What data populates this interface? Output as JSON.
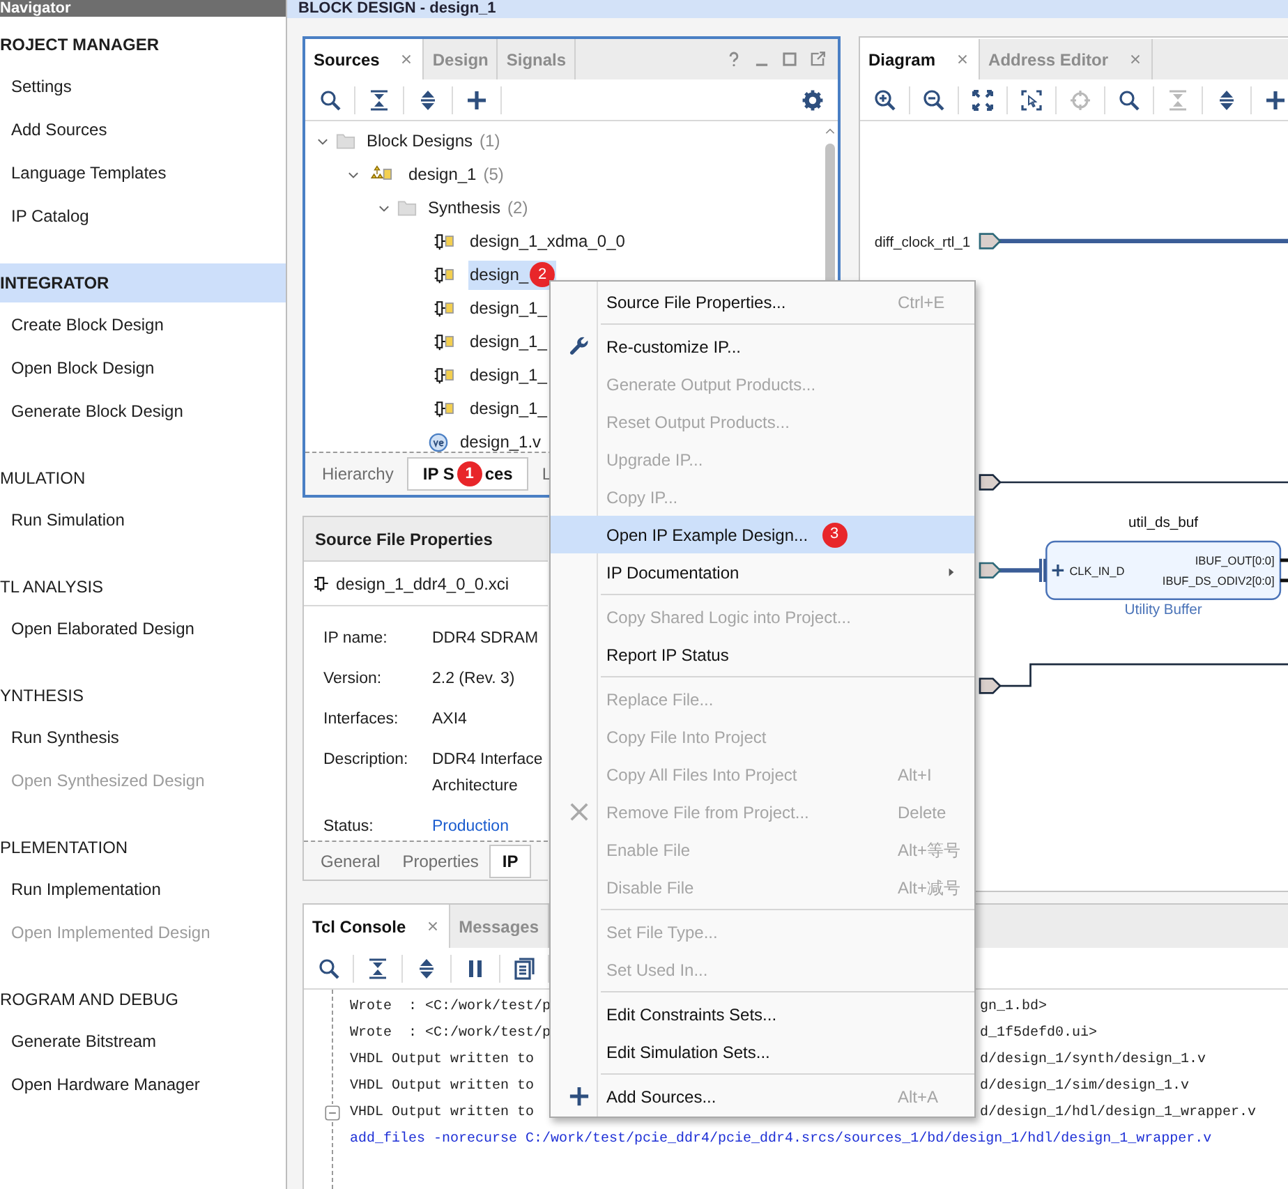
{
  "navigator": {
    "title": "Navigator",
    "sections": [
      {
        "title": "ROJECT MANAGER",
        "emphasized": true,
        "selected": false,
        "items": [
          {
            "label": "Settings",
            "disabled": false
          },
          {
            "label": "Add Sources",
            "disabled": false
          },
          {
            "label": "Language Templates",
            "disabled": false
          },
          {
            "label": "IP Catalog",
            "disabled": false
          }
        ]
      },
      {
        "title": "INTEGRATOR",
        "emphasized": true,
        "selected": true,
        "items": [
          {
            "label": "Create Block Design",
            "disabled": false
          },
          {
            "label": "Open Block Design",
            "disabled": false
          },
          {
            "label": "Generate Block Design",
            "disabled": false
          }
        ]
      },
      {
        "title": "MULATION",
        "emphasized": false,
        "selected": false,
        "items": [
          {
            "label": "Run Simulation",
            "disabled": false
          }
        ]
      },
      {
        "title": "TL ANALYSIS",
        "emphasized": false,
        "selected": false,
        "items": [
          {
            "label": "Open Elaborated Design",
            "disabled": false
          }
        ]
      },
      {
        "title": "YNTHESIS",
        "emphasized": false,
        "selected": false,
        "items": [
          {
            "label": "Run Synthesis",
            "disabled": false
          },
          {
            "label": "Open Synthesized Design",
            "disabled": true
          }
        ]
      },
      {
        "title": "PLEMENTATION",
        "emphasized": false,
        "selected": false,
        "items": [
          {
            "label": "Run Implementation",
            "disabled": false
          },
          {
            "label": "Open Implemented Design",
            "disabled": true
          }
        ]
      },
      {
        "title": "ROGRAM AND DEBUG",
        "emphasized": false,
        "selected": false,
        "items": [
          {
            "label": "Generate Bitstream",
            "disabled": false
          },
          {
            "label": "Open Hardware Manager",
            "disabled": false
          }
        ]
      }
    ]
  },
  "header": "BLOCK DESIGN - design_1",
  "sources": {
    "tabs": [
      {
        "label": "Sources",
        "selected": true,
        "closable": true
      },
      {
        "label": "Design",
        "selected": false,
        "closable": false
      },
      {
        "label": "Signals",
        "selected": false,
        "closable": false
      }
    ],
    "toolbar": [
      {
        "kind": "search",
        "disabled": false
      },
      {
        "kind": "collapse",
        "disabled": false
      },
      {
        "kind": "expand",
        "disabled": false
      },
      {
        "kind": "add",
        "disabled": false
      },
      {
        "kind": "settings",
        "disabled": false
      }
    ],
    "tree": [
      {
        "label": "Block Designs",
        "count": "(1)",
        "kind": "folder",
        "selected": false,
        "expanded": true,
        "children": [
          {
            "label": "design_1",
            "count": "(5)",
            "kind": "design",
            "selected": false,
            "expanded": true,
            "children": [
              {
                "label": "Synthesis",
                "count": "(2)",
                "kind": "folder",
                "selected": false,
                "expanded": true,
                "children": [
                  {
                    "label": "design_1_xdma_0_0",
                    "kind": "ip",
                    "selected": false
                  },
                  {
                    "label": "design_",
                    "kind": "ip",
                    "selected": true,
                    "badge": "2"
                  },
                  {
                    "label": "design_1_",
                    "kind": "ip",
                    "selected": false
                  },
                  {
                    "label": "design_1_",
                    "kind": "ip",
                    "selected": false
                  },
                  {
                    "label": "design_1_",
                    "kind": "ip",
                    "selected": false
                  },
                  {
                    "label": "design_1_",
                    "kind": "ip",
                    "selected": false
                  },
                  {
                    "label": "design_1.v",
                    "kind": "file",
                    "selected": false
                  }
                ]
              }
            ]
          }
        ]
      }
    ],
    "bottom_tabs": [
      {
        "label": "Hierarchy",
        "selected": false
      },
      {
        "label": "IP S",
        "badge": "1",
        "label_end": "ces",
        "selected": true
      },
      {
        "label": "L",
        "selected": false
      }
    ]
  },
  "properties": {
    "title": "Source File Properties",
    "file": "design_1_ddr4_0_0.xci",
    "fields": [
      {
        "label": "IP name:",
        "lines": [
          "DDR4 SDRAM"
        ],
        "kind": "text"
      },
      {
        "label": "Version:",
        "lines": [
          "2.2 (Rev. 3)"
        ],
        "kind": "text"
      },
      {
        "label": "Interfaces:",
        "lines": [
          "AXI4"
        ],
        "kind": "text"
      },
      {
        "label": "Description:",
        "lines": [
          "DDR4 Interface",
          "Architecture"
        ],
        "kind": "text"
      },
      {
        "label": "Status:",
        "lines": [
          "Production"
        ],
        "kind": "link"
      }
    ],
    "tabs": [
      {
        "label": "General",
        "selected": false
      },
      {
        "label": "Properties",
        "selected": false
      },
      {
        "label": "IP",
        "selected": true
      }
    ]
  },
  "diagram": {
    "tabs": [
      {
        "label": "Diagram",
        "selected": true,
        "closable": true
      },
      {
        "label": "Address Editor",
        "selected": false,
        "closable": true
      }
    ],
    "toolbar": [
      {
        "kind": "zoom_in",
        "disabled": false
      },
      {
        "kind": "zoom_out",
        "disabled": false
      },
      {
        "kind": "fit",
        "disabled": false
      },
      {
        "kind": "select_area",
        "disabled": false
      },
      {
        "kind": "center",
        "disabled": true
      },
      {
        "kind": "search",
        "disabled": false
      },
      {
        "kind": "collapse",
        "disabled": true
      },
      {
        "kind": "expand",
        "disabled": false
      },
      {
        "kind": "add",
        "disabled": false
      }
    ],
    "ports": [
      {
        "label": "diff_clock_rtl_1",
        "kind": "bus"
      },
      {
        "kind": "net"
      },
      {
        "kind": "bus"
      },
      {
        "kind": "net"
      }
    ],
    "block": {
      "name": "util_ds_buf",
      "type": "Utility Buffer",
      "inputs": [
        "CLK_IN_D"
      ],
      "outputs": [
        "IBUF_OUT[0:0]",
        "IBUF_DS_ODIV2[0:0]"
      ]
    }
  },
  "console": {
    "tabs": [
      {
        "label": "Tcl Console",
        "selected": true,
        "closable": true
      },
      {
        "label": "Messages",
        "selected": false,
        "closable": false
      }
    ],
    "toolbar": [
      {
        "kind": "search",
        "disabled": false
      },
      {
        "kind": "collapse",
        "disabled": false
      },
      {
        "kind": "expand",
        "disabled": false
      },
      {
        "kind": "pause",
        "disabled": false
      },
      {
        "kind": "copy",
        "disabled": false
      }
    ],
    "lines": [
      {
        "kind": "output",
        "text": "Wrote  : <C:/work/test/p",
        "tail": "gn_1.bd>"
      },
      {
        "kind": "output",
        "text": "Wrote  : <C:/work/test/p",
        "tail": "d_1f5defd0.ui>"
      },
      {
        "kind": "output",
        "text": "VHDL Output written to",
        "tail": "d/design_1/synth/design_1.v"
      },
      {
        "kind": "output",
        "text": "VHDL Output written to",
        "tail": "d/design_1/sim/design_1.v"
      },
      {
        "kind": "output",
        "text": "VHDL Output written to",
        "tail": "d/design_1/hdl/design_1_wrapper.v",
        "fold": true
      },
      {
        "kind": "command",
        "text": "add_files -norecurse C:/work/test/pcie_ddr4/pcie_ddr4.srcs/sources_1/bd/design_1/hdl/design_1_wrapper.v"
      }
    ]
  },
  "context_menu": [
    {
      "kind": "item",
      "label": "Source File Properties...",
      "shortcut": "Ctrl+E",
      "disabled": false,
      "selected": false
    },
    {
      "kind": "separator"
    },
    {
      "kind": "customize",
      "label": "Re-customize IP...",
      "disabled": false,
      "selected": false
    },
    {
      "kind": "item",
      "label": "Generate Output Products...",
      "disabled": true,
      "selected": false
    },
    {
      "kind": "item",
      "label": "Reset Output Products...",
      "disabled": true,
      "selected": false
    },
    {
      "kind": "item",
      "label": "Upgrade IP...",
      "disabled": true,
      "selected": false
    },
    {
      "kind": "item",
      "label": "Copy IP...",
      "disabled": true,
      "selected": false
    },
    {
      "kind": "item",
      "label": "Open IP Example Design...",
      "disabled": false,
      "selected": true,
      "badge": "3"
    },
    {
      "kind": "item",
      "label": "IP Documentation",
      "disabled": false,
      "selected": false,
      "submenu": true
    },
    {
      "kind": "separator"
    },
    {
      "kind": "item",
      "label": "Copy Shared Logic into Project...",
      "disabled": true,
      "selected": false
    },
    {
      "kind": "item",
      "label": "Report IP Status",
      "disabled": false,
      "selected": false
    },
    {
      "kind": "separator"
    },
    {
      "kind": "item",
      "label": "Replace File...",
      "disabled": true,
      "selected": false
    },
    {
      "kind": "item",
      "label": "Copy File Into Project",
      "disabled": true,
      "selected": false
    },
    {
      "kind": "item",
      "label": "Copy All Files Into Project",
      "shortcut": "Alt+I",
      "disabled": true,
      "selected": false
    },
    {
      "kind": "remove",
      "label": "Remove File from Project...",
      "shortcut": "Delete",
      "disabled": true,
      "selected": false
    },
    {
      "kind": "item",
      "label": "Enable File",
      "shortcut": "Alt+等号",
      "disabled": true,
      "selected": false
    },
    {
      "kind": "item",
      "label": "Disable File",
      "shortcut": "Alt+减号",
      "disabled": true,
      "selected": false
    },
    {
      "kind": "separator"
    },
    {
      "kind": "item",
      "label": "Set File Type...",
      "disabled": true,
      "selected": false
    },
    {
      "kind": "item",
      "label": "Set Used In...",
      "disabled": true,
      "selected": false
    },
    {
      "kind": "separator"
    },
    {
      "kind": "item",
      "label": "Edit Constraints Sets...",
      "disabled": false,
      "selected": false
    },
    {
      "kind": "item",
      "label": "Edit Simulation Sets...",
      "disabled": false,
      "selected": false
    },
    {
      "kind": "separator"
    },
    {
      "kind": "add",
      "label": "Add Sources...",
      "shortcut": "Alt+A",
      "disabled": false,
      "selected": false
    }
  ]
}
